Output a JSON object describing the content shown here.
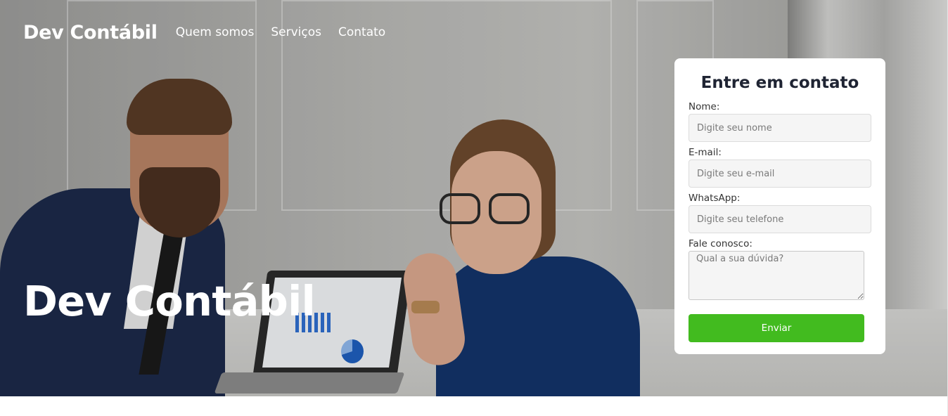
{
  "header": {
    "brand": "Dev Contábil",
    "nav": [
      {
        "label": "Quem somos"
      },
      {
        "label": "Serviços"
      },
      {
        "label": "Contato"
      }
    ]
  },
  "hero": {
    "title": "Dev Contábil",
    "background_image": "office-meeting-photo"
  },
  "contact_form": {
    "title": "Entre em contato",
    "fields": {
      "name": {
        "label": "Nome:",
        "placeholder": "Digite seu nome",
        "value": ""
      },
      "email": {
        "label": "E-mail:",
        "placeholder": "Digite seu e-mail",
        "value": ""
      },
      "whatsapp": {
        "label": "WhatsApp:",
        "placeholder": "Digite seu telefone",
        "value": ""
      },
      "message": {
        "label": "Fale conosco:",
        "placeholder": "Qual a sua dúvida?",
        "value": ""
      }
    },
    "submit_label": "Enviar"
  },
  "colors": {
    "submit_button": "#42bb1f",
    "form_title": "#1f2433",
    "nav_text": "#ffffff",
    "card_background": "#ffffff"
  }
}
